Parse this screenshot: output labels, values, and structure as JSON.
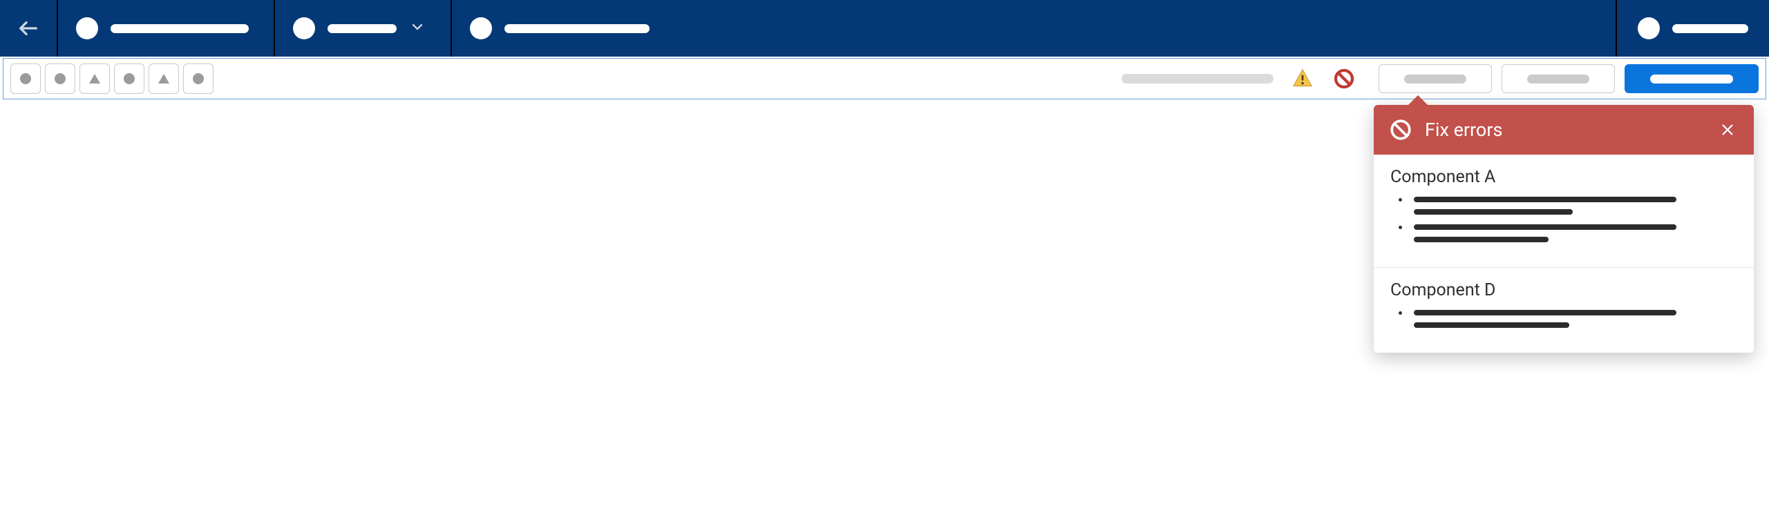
{
  "header": {
    "tabs": [
      {
        "has_dropdown": false,
        "label_width": 200
      },
      {
        "has_dropdown": true,
        "label_width": 100
      },
      {
        "has_dropdown": false,
        "label_width": 210
      }
    ],
    "right_label_width": 110
  },
  "toolbar": {
    "buttons": [
      {
        "icon": "circle"
      },
      {
        "icon": "circle"
      },
      {
        "icon": "triangle"
      },
      {
        "icon": "circle"
      },
      {
        "icon": "triangle"
      },
      {
        "icon": "circle"
      }
    ],
    "status_placeholder_width": 220,
    "warning_visible": true,
    "error_visible": true,
    "secondary_buttons": 2
  },
  "popover": {
    "title": "Fix errors",
    "sections": [
      {
        "name": "Component A",
        "items": [
          {
            "lines": [
              380,
              230
            ]
          },
          {
            "lines": [
              380,
              195
            ]
          }
        ]
      },
      {
        "name": "Component D",
        "items": [
          {
            "lines": [
              380,
              225
            ]
          }
        ]
      }
    ]
  }
}
